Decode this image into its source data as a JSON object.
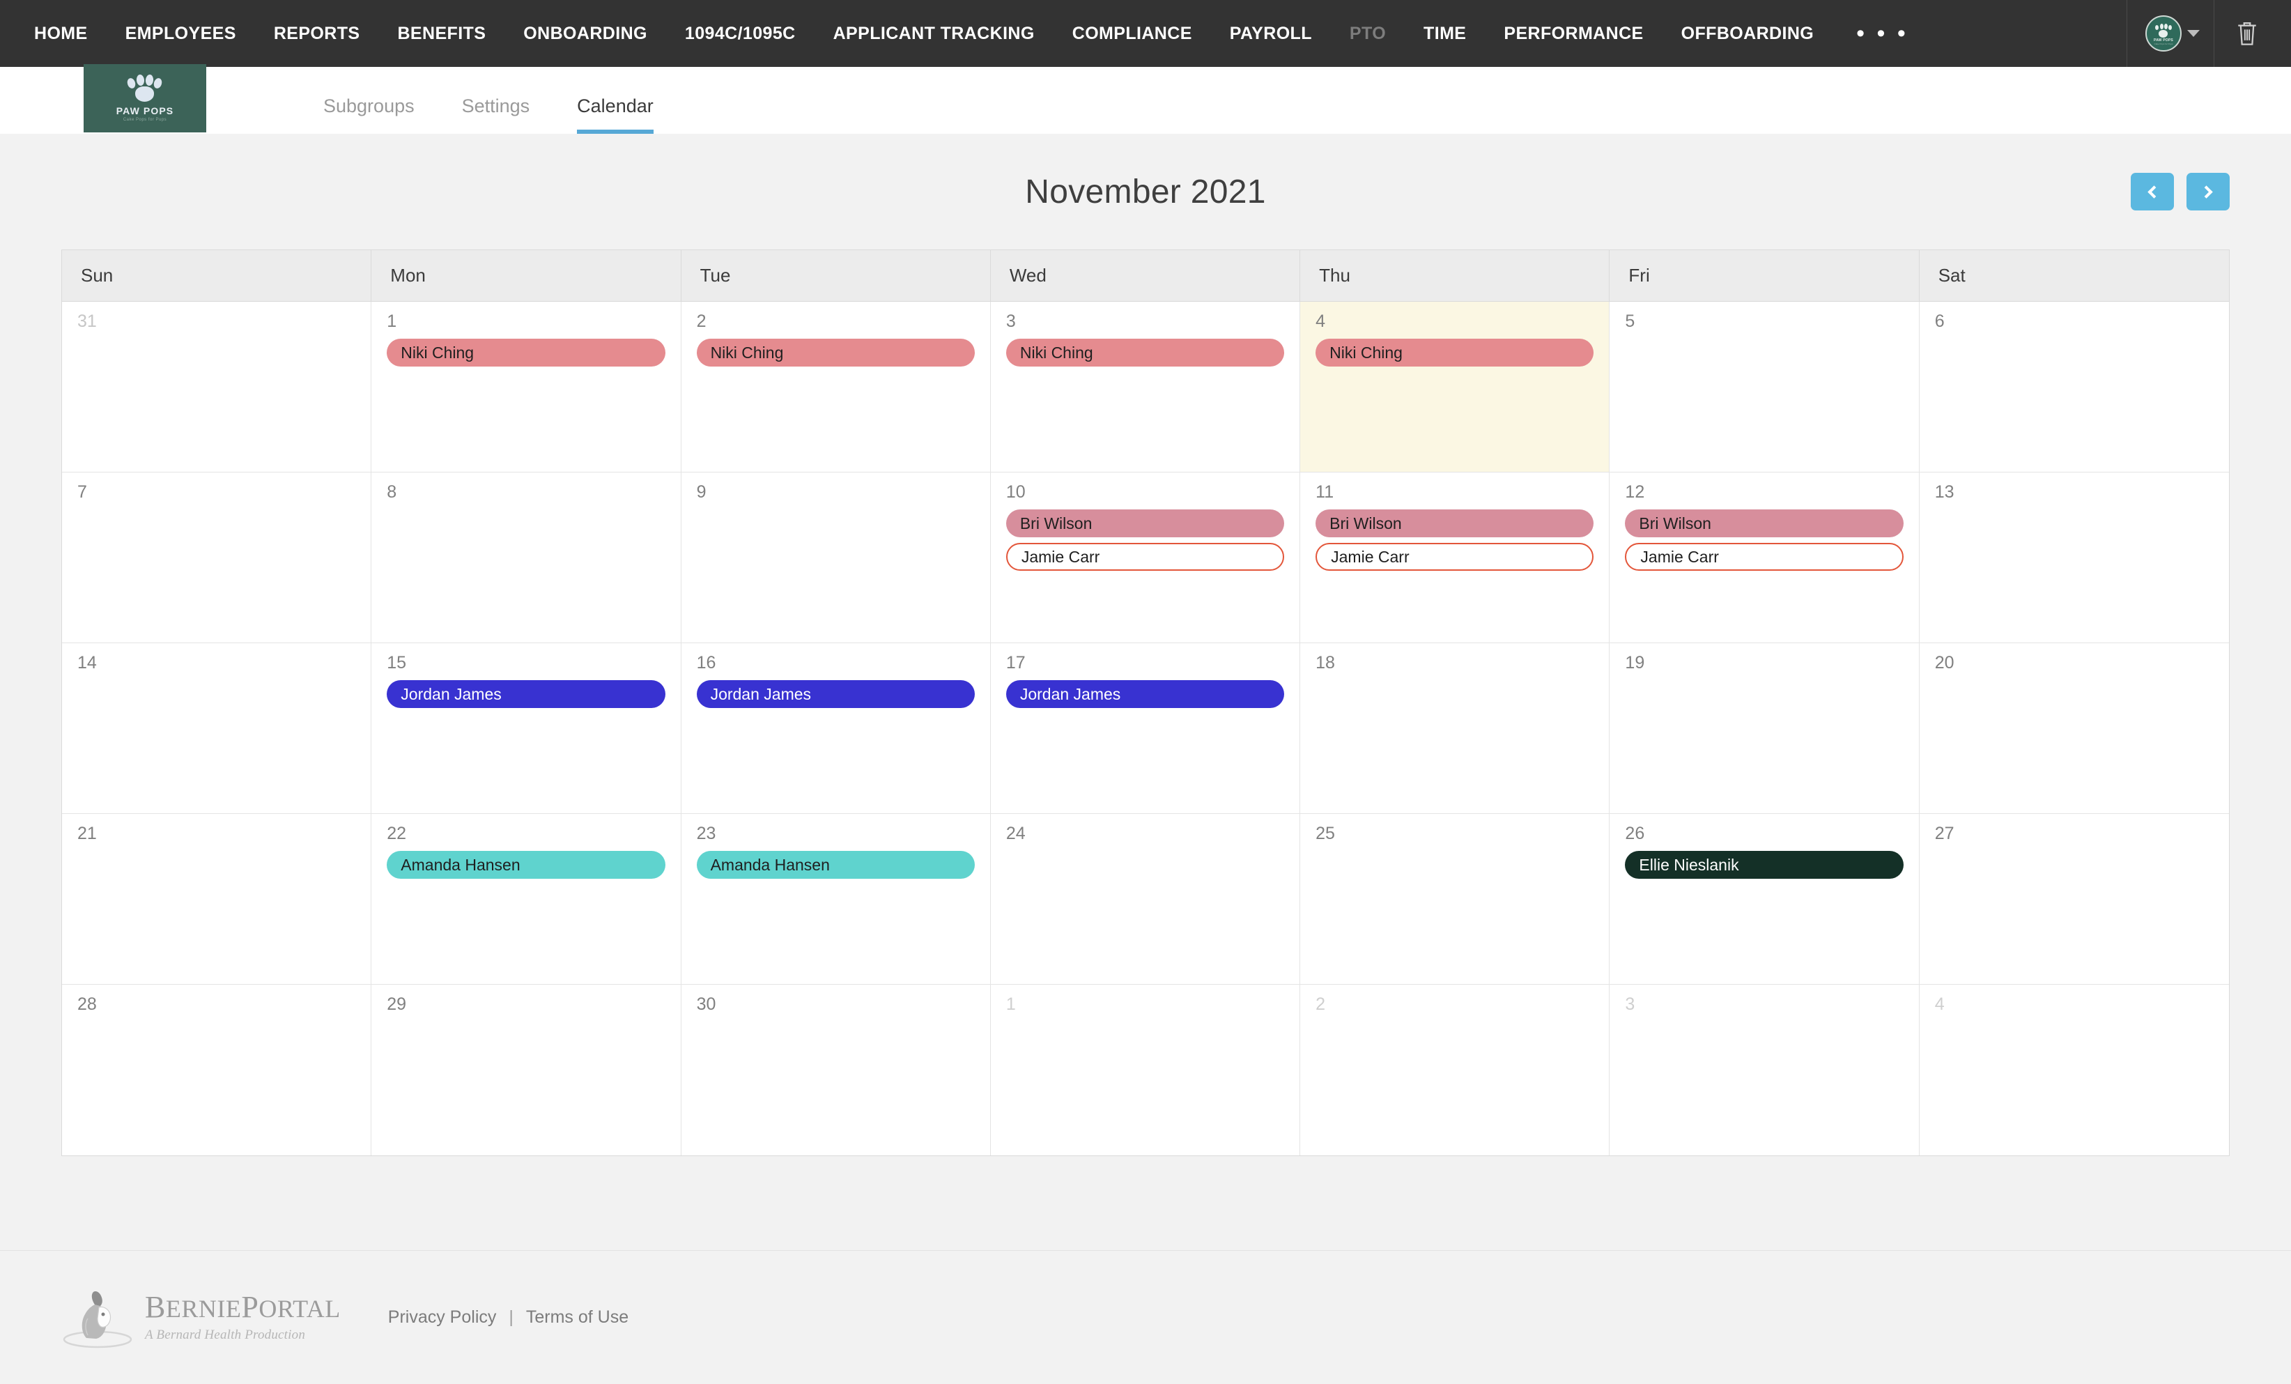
{
  "topnav": {
    "items": [
      {
        "label": "HOME",
        "dim": false
      },
      {
        "label": "EMPLOYEES",
        "dim": false
      },
      {
        "label": "REPORTS",
        "dim": false
      },
      {
        "label": "BENEFITS",
        "dim": false
      },
      {
        "label": "ONBOARDING",
        "dim": false
      },
      {
        "label": "1094C/1095C",
        "dim": false
      },
      {
        "label": "APPLICANT TRACKING",
        "dim": false
      },
      {
        "label": "COMPLIANCE",
        "dim": false
      },
      {
        "label": "PAYROLL",
        "dim": false
      },
      {
        "label": "PTO",
        "dim": true
      },
      {
        "label": "TIME",
        "dim": false
      },
      {
        "label": "PERFORMANCE",
        "dim": false
      },
      {
        "label": "OFFBOARDING",
        "dim": false
      }
    ],
    "overflow_label": "• • •",
    "background": "#333333",
    "avatar_icon": "paw-avatar-icon",
    "caret_icon": "chevron-down-icon",
    "trash_icon": "trash-icon"
  },
  "brand": {
    "name": "PAW POPS",
    "tagline": "Cake Pops for Pups",
    "box_color": "#3c6358"
  },
  "subtabs": [
    {
      "label": "Subgroups",
      "active": false
    },
    {
      "label": "Settings",
      "active": false
    },
    {
      "label": "Calendar",
      "active": true
    }
  ],
  "calendar": {
    "title": "November 2021",
    "prev_label": "‹",
    "next_label": "›",
    "accent": "#5bb8e0",
    "today_bg": "#fbf7e3",
    "weekdays": [
      "Sun",
      "Mon",
      "Tue",
      "Wed",
      "Thu",
      "Fri",
      "Sat"
    ],
    "legend_colors": {
      "niki": "#e58b8f",
      "bri": "#d78e9c",
      "jamie_border": "#e3563a",
      "jordan": "#3832d1",
      "amanda": "#5fd3ce",
      "ellie": "#143027"
    },
    "weeks": [
      [
        {
          "day": "31",
          "muted": "prev",
          "today": false,
          "events": []
        },
        {
          "day": "1",
          "muted": "",
          "today": false,
          "events": [
            {
              "label": "Niki Ching",
              "style": "niki"
            }
          ]
        },
        {
          "day": "2",
          "muted": "",
          "today": false,
          "events": [
            {
              "label": "Niki Ching",
              "style": "niki"
            }
          ]
        },
        {
          "day": "3",
          "muted": "",
          "today": false,
          "events": [
            {
              "label": "Niki Ching",
              "style": "niki"
            }
          ]
        },
        {
          "day": "4",
          "muted": "",
          "today": true,
          "events": [
            {
              "label": "Niki Ching",
              "style": "niki"
            }
          ]
        },
        {
          "day": "5",
          "muted": "",
          "today": false,
          "events": []
        },
        {
          "day": "6",
          "muted": "",
          "today": false,
          "events": []
        }
      ],
      [
        {
          "day": "7",
          "muted": "",
          "today": false,
          "events": []
        },
        {
          "day": "8",
          "muted": "",
          "today": false,
          "events": []
        },
        {
          "day": "9",
          "muted": "",
          "today": false,
          "events": []
        },
        {
          "day": "10",
          "muted": "",
          "today": false,
          "events": [
            {
              "label": "Bri Wilson",
              "style": "bri"
            },
            {
              "label": "Jamie Carr",
              "style": "jamie"
            }
          ]
        },
        {
          "day": "11",
          "muted": "",
          "today": false,
          "events": [
            {
              "label": "Bri Wilson",
              "style": "bri"
            },
            {
              "label": "Jamie Carr",
              "style": "jamie"
            }
          ]
        },
        {
          "day": "12",
          "muted": "",
          "today": false,
          "events": [
            {
              "label": "Bri Wilson",
              "style": "bri"
            },
            {
              "label": "Jamie Carr",
              "style": "jamie"
            }
          ]
        },
        {
          "day": "13",
          "muted": "",
          "today": false,
          "events": []
        }
      ],
      [
        {
          "day": "14",
          "muted": "",
          "today": false,
          "events": []
        },
        {
          "day": "15",
          "muted": "",
          "today": false,
          "events": [
            {
              "label": "Jordan James",
              "style": "jordan"
            }
          ]
        },
        {
          "day": "16",
          "muted": "",
          "today": false,
          "events": [
            {
              "label": "Jordan James",
              "style": "jordan"
            }
          ]
        },
        {
          "day": "17",
          "muted": "",
          "today": false,
          "events": [
            {
              "label": "Jordan James",
              "style": "jordan"
            }
          ]
        },
        {
          "day": "18",
          "muted": "",
          "today": false,
          "events": []
        },
        {
          "day": "19",
          "muted": "",
          "today": false,
          "events": []
        },
        {
          "day": "20",
          "muted": "",
          "today": false,
          "events": []
        }
      ],
      [
        {
          "day": "21",
          "muted": "",
          "today": false,
          "events": []
        },
        {
          "day": "22",
          "muted": "",
          "today": false,
          "events": [
            {
              "label": "Amanda Hansen",
              "style": "amanda"
            }
          ]
        },
        {
          "day": "23",
          "muted": "",
          "today": false,
          "events": [
            {
              "label": "Amanda Hansen",
              "style": "amanda"
            }
          ]
        },
        {
          "day": "24",
          "muted": "",
          "today": false,
          "events": []
        },
        {
          "day": "25",
          "muted": "",
          "today": false,
          "events": []
        },
        {
          "day": "26",
          "muted": "",
          "today": false,
          "events": [
            {
              "label": "Ellie Nieslanik",
              "style": "ellie"
            }
          ]
        },
        {
          "day": "27",
          "muted": "",
          "today": false,
          "events": []
        }
      ],
      [
        {
          "day": "28",
          "muted": "",
          "today": false,
          "events": []
        },
        {
          "day": "29",
          "muted": "",
          "today": false,
          "events": []
        },
        {
          "day": "30",
          "muted": "",
          "today": false,
          "events": []
        },
        {
          "day": "1",
          "muted": "other",
          "today": false,
          "events": []
        },
        {
          "day": "2",
          "muted": "other",
          "today": false,
          "events": []
        },
        {
          "day": "3",
          "muted": "other",
          "today": false,
          "events": []
        },
        {
          "day": "4",
          "muted": "other",
          "today": false,
          "events": []
        }
      ]
    ]
  },
  "footer": {
    "brand_name_parts": [
      "B",
      "ERNIE",
      "P",
      "ORTAL"
    ],
    "brand_name": "BerniePortal",
    "brand_sub": "A Bernard Health Production",
    "links": [
      {
        "label": "Privacy Policy"
      },
      {
        "label": "Terms of Use"
      }
    ],
    "separator": "|"
  }
}
